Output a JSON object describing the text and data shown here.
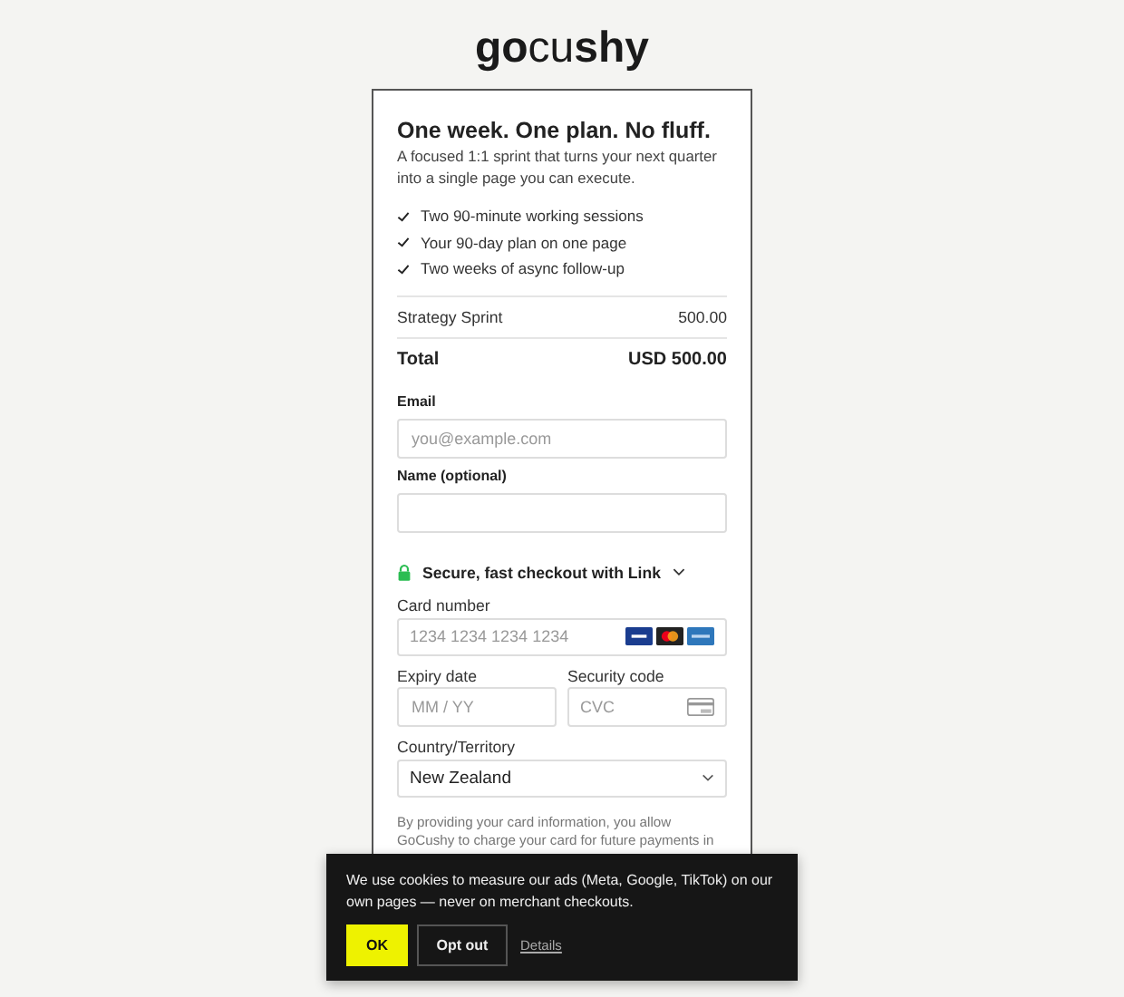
{
  "logo": {
    "bold_start": "go",
    "light_middle": "cu",
    "bold_end": "shy"
  },
  "offer": {
    "title": "One week. One plan. No fluff.",
    "subtitle": "A focused 1:1 sprint that turns your next quarter into a single page you can execute.",
    "features": [
      "Two 90-minute working sessions",
      "Your 90-day plan on one page",
      "Two weeks of async follow-up"
    ]
  },
  "line_item": {
    "name": "Strategy Sprint",
    "amount": "500.00"
  },
  "total": {
    "label": "Total",
    "amount": "USD 500.00"
  },
  "email": {
    "label": "Email",
    "placeholder": "you@example.com"
  },
  "name": {
    "label": "Name (optional)"
  },
  "link": {
    "label": "Secure, fast checkout with Link",
    "expanded": false
  },
  "card": {
    "label": "Card number",
    "placeholder": "1234 1234 1234 1234"
  },
  "expiry": {
    "label": "Expiry date",
    "placeholder": "MM / YY"
  },
  "cvc": {
    "label": "Security code",
    "placeholder": "CVC"
  },
  "country": {
    "label": "Country/Territory",
    "value": "New Zealand"
  },
  "consent": "By providing your card information, you allow GoCushy to charge your card for future payments in",
  "cookie_banner": {
    "text": "We use cookies to measure our ads (Meta, Google, TikTok) on our own pages — never on merchant checkouts.",
    "ok": "OK",
    "opt_out": "Opt out",
    "details": "Details"
  }
}
